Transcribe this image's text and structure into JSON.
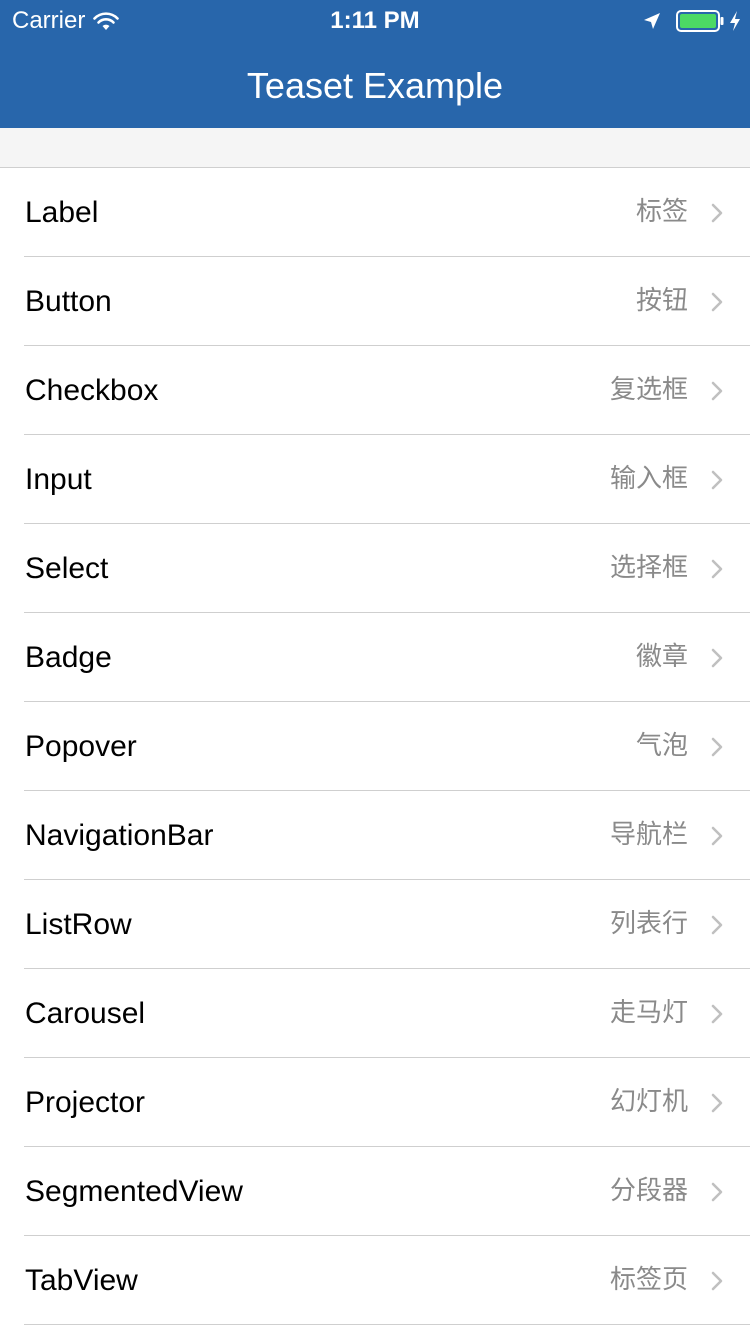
{
  "status_bar": {
    "carrier": "Carrier",
    "time": "1:11 PM",
    "icons": [
      "wifi-icon",
      "location-icon",
      "battery-icon",
      "charging-bolt-icon"
    ],
    "battery_color": "#4cd964"
  },
  "nav_bar": {
    "title": "Teaset Example",
    "background": "#2866ab"
  },
  "list": {
    "items": [
      {
        "label": "Label",
        "detail": "标签"
      },
      {
        "label": "Button",
        "detail": "按钮"
      },
      {
        "label": "Checkbox",
        "detail": "复选框"
      },
      {
        "label": "Input",
        "detail": "输入框"
      },
      {
        "label": "Select",
        "detail": "选择框"
      },
      {
        "label": "Badge",
        "detail": "徽章"
      },
      {
        "label": "Popover",
        "detail": "气泡"
      },
      {
        "label": "NavigationBar",
        "detail": "导航栏"
      },
      {
        "label": "ListRow",
        "detail": "列表行"
      },
      {
        "label": "Carousel",
        "detail": "走马灯"
      },
      {
        "label": "Projector",
        "detail": "幻灯机"
      },
      {
        "label": "SegmentedView",
        "detail": "分段器"
      },
      {
        "label": "TabView",
        "detail": "标签页"
      }
    ],
    "accessory_icon": "chevron-right-icon"
  }
}
